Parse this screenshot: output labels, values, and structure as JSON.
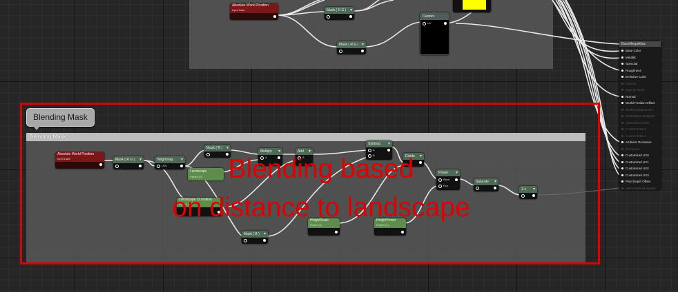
{
  "annotation": {
    "label_line1": "Blending based",
    "label_line2": "on distance to landscape",
    "color": "#e00000"
  },
  "comment": {
    "bubble_text": "Blending Mask",
    "bar_text": "Blending Mask"
  },
  "top_group": {
    "abs_world_title": "Absolute World Position",
    "abs_world_sub": "Input Data",
    "mask_rg_top": "Mask ( R G )",
    "mask_rg_lower": "Mask ( R G )",
    "custom_title": "Custom",
    "custom_uv": "UV",
    "texture_swatch_color": "#ffff00"
  },
  "blend_nodes": {
    "abs_world_title": "Absolute World Position",
    "abs_world_sub": "Input Data",
    "mask_rg": "Mask ( R G )",
    "heightmap": "Heightmap",
    "heightmap_uvs": "UVs",
    "mask_r_top": "Mask ( R )",
    "landscape_top": "Landscape",
    "landscape_top_sub": "Param (0)",
    "landscape_mid": "Landscape ZLocation",
    "landscape_mid_sub": "Param (0)",
    "mask_b": "Mask ( B )",
    "multiply": "Multiply",
    "add": "Add",
    "subtract": "Subtract",
    "pin_a": "A",
    "pin_b": "B",
    "divide": "Divide",
    "height_scale": "HeightScale",
    "height_scale_sub": "Param (1)",
    "height_power": "HeightPower",
    "height_power_sub": "Param (1)",
    "power": "Power",
    "power_base": "Base",
    "power_exp": "Exp",
    "saturate": "Saturate",
    "one_minus": "1-x"
  },
  "material_output": {
    "title": "BaseMegaAtlas",
    "pins": [
      {
        "label": "Base Color",
        "active": true
      },
      {
        "label": "Metallic",
        "active": true
      },
      {
        "label": "Specular",
        "active": true
      },
      {
        "label": "Roughness",
        "active": true
      },
      {
        "label": "Emissive Color",
        "active": true
      },
      {
        "label": "Opacity",
        "active": false
      },
      {
        "label": "Opacity Mask",
        "active": false
      },
      {
        "label": "Normal",
        "active": true
      },
      {
        "label": "World Position Offset",
        "active": true
      },
      {
        "label": "World Displacement",
        "active": false
      },
      {
        "label": "Tessellation Multiplier",
        "active": false
      },
      {
        "label": "Subsurface Color",
        "active": false
      },
      {
        "label": "Custom Data 0",
        "active": false
      },
      {
        "label": "Custom Data 1",
        "active": false
      },
      {
        "label": "Ambient Occlusion",
        "active": true
      },
      {
        "label": "Refraction",
        "active": false
      },
      {
        "label": "Customized UV0",
        "active": true
      },
      {
        "label": "Customized UV1",
        "active": true
      },
      {
        "label": "Customized UV2",
        "active": true
      },
      {
        "label": "Customized UV3",
        "active": true
      },
      {
        "label": "Pixel Depth Offset",
        "active": true
      },
      {
        "label": "Mesh Material Weight",
        "active": false
      }
    ]
  }
}
